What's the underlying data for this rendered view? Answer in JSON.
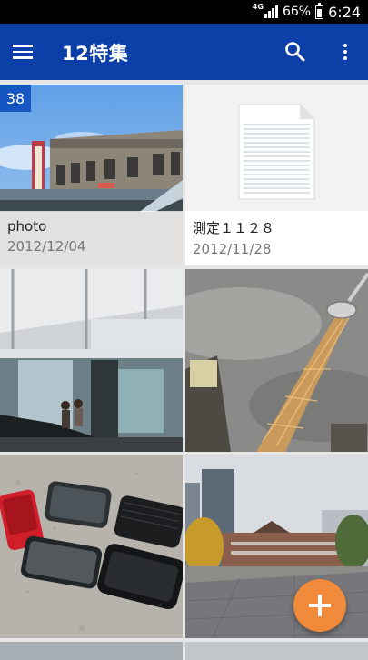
{
  "status_bar": {
    "network": "4G",
    "battery": "66%",
    "time": "6:24"
  },
  "app_bar": {
    "title": "12特集",
    "menu_icon": "hamburger-menu-icon",
    "search_icon": "search-icon",
    "more_icon": "more-vert-icon"
  },
  "albums": [
    {
      "name": "photo",
      "date": "2012/12/04",
      "count": "38",
      "thumbnail": "station-building-photo"
    },
    {
      "name": "測定１１２８",
      "date": "2012/11/28",
      "thumbnail": "document-file-icon"
    }
  ],
  "photos": [
    "station-entrance-escalator",
    "tokyo-skytree-tower",
    "smartphones-on-stone",
    "tokyo-station-plaza"
  ],
  "fab": {
    "icon": "plus-icon",
    "color": "#f28a3c"
  },
  "colors": {
    "app_bar": "#0c3fa8",
    "badge": "#1556c2",
    "status_bar": "#000000"
  }
}
